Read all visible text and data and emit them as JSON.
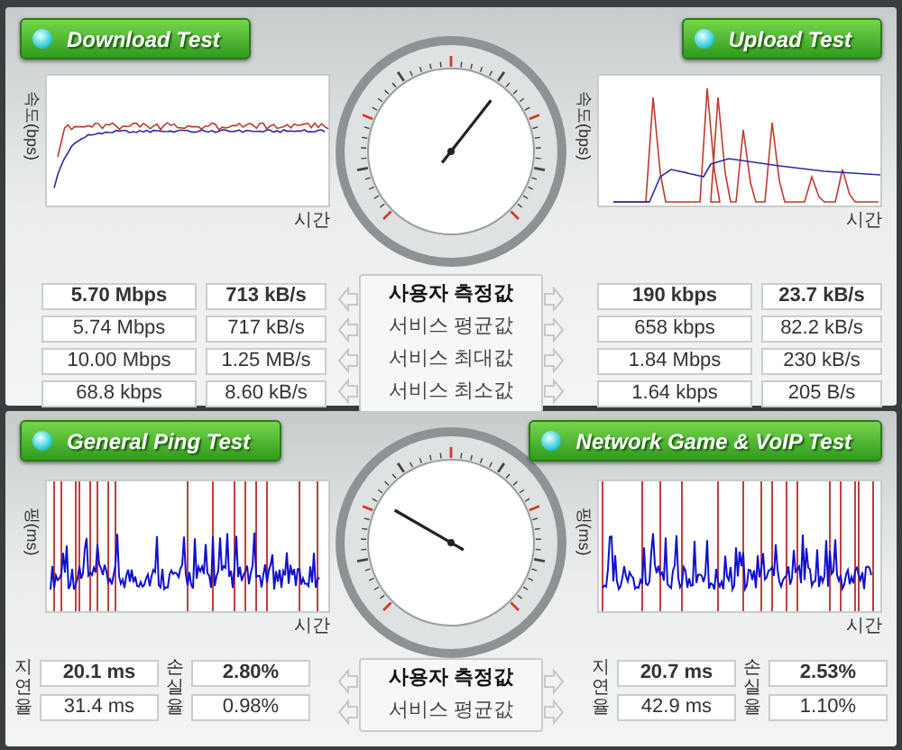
{
  "top": {
    "row_labels": [
      "사용자 측정값",
      "서비스 평균값",
      "서비스 최대값",
      "서비스 최소값"
    ],
    "download": {
      "title": "Download Test",
      "y_axis_label": "속도(bps)",
      "x_axis_label": "시간",
      "rows": [
        [
          "5.70 Mbps",
          "713 kB/s"
        ],
        [
          "5.74 Mbps",
          "717 kB/s"
        ],
        [
          "10.00 Mbps",
          "1.25 MB/s"
        ],
        [
          "68.8 kbps",
          "8.60 kB/s"
        ]
      ]
    },
    "upload": {
      "title": "Upload Test",
      "y_axis_label": "속도(bps)",
      "x_axis_label": "시간",
      "rows": [
        [
          "190 kbps",
          "23.7 kB/s"
        ],
        [
          "658 kbps",
          "82.2 kB/s"
        ],
        [
          "1.84 Mbps",
          "230 kB/s"
        ],
        [
          "1.64 kbps",
          "205 B/s"
        ]
      ]
    }
  },
  "bottom": {
    "row_labels": [
      "사용자 측정값",
      "서비스 평균값"
    ],
    "ping": {
      "title": "General Ping Test",
      "y_axis_label": "핑(ms)",
      "x_axis_label": "시간",
      "stat_labels": [
        "지연율",
        "손실율"
      ],
      "rows": [
        [
          "20.1 ms",
          "2.80%"
        ],
        [
          "31.4 ms",
          "0.98%"
        ]
      ]
    },
    "game": {
      "title": "Network Game & VoIP Test",
      "y_axis_label": "핑(ms)",
      "x_axis_label": "시간",
      "stat_labels": [
        "지연율",
        "손실율"
      ],
      "rows": [
        [
          "20.7 ms",
          "2.53%"
        ],
        [
          "42.9 ms",
          "1.10%"
        ]
      ]
    }
  }
}
